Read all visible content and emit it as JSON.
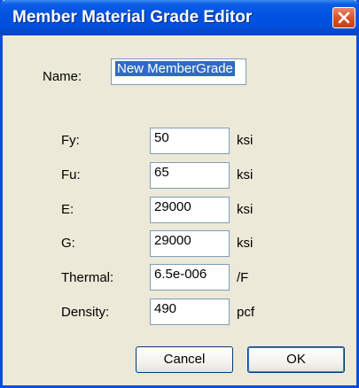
{
  "window": {
    "title": "Member Material Grade Editor",
    "accent_color": "#0a4ee0",
    "close_icon": "close-icon"
  },
  "name_field": {
    "label": "Name:",
    "value": "New MemberGrade"
  },
  "properties": [
    {
      "label": "Fy:",
      "value": "50",
      "unit": "ksi"
    },
    {
      "label": "Fu:",
      "value": "65",
      "unit": "ksi"
    },
    {
      "label": "E:",
      "value": "29000",
      "unit": "ksi"
    },
    {
      "label": "G:",
      "value": "29000",
      "unit": "ksi"
    },
    {
      "label": "Thermal:",
      "value": "6.5e-006",
      "unit": "/F"
    },
    {
      "label": "Density:",
      "value": "490",
      "unit": "pcf"
    }
  ],
  "buttons": {
    "cancel_label": "Cancel",
    "ok_label": "OK"
  }
}
